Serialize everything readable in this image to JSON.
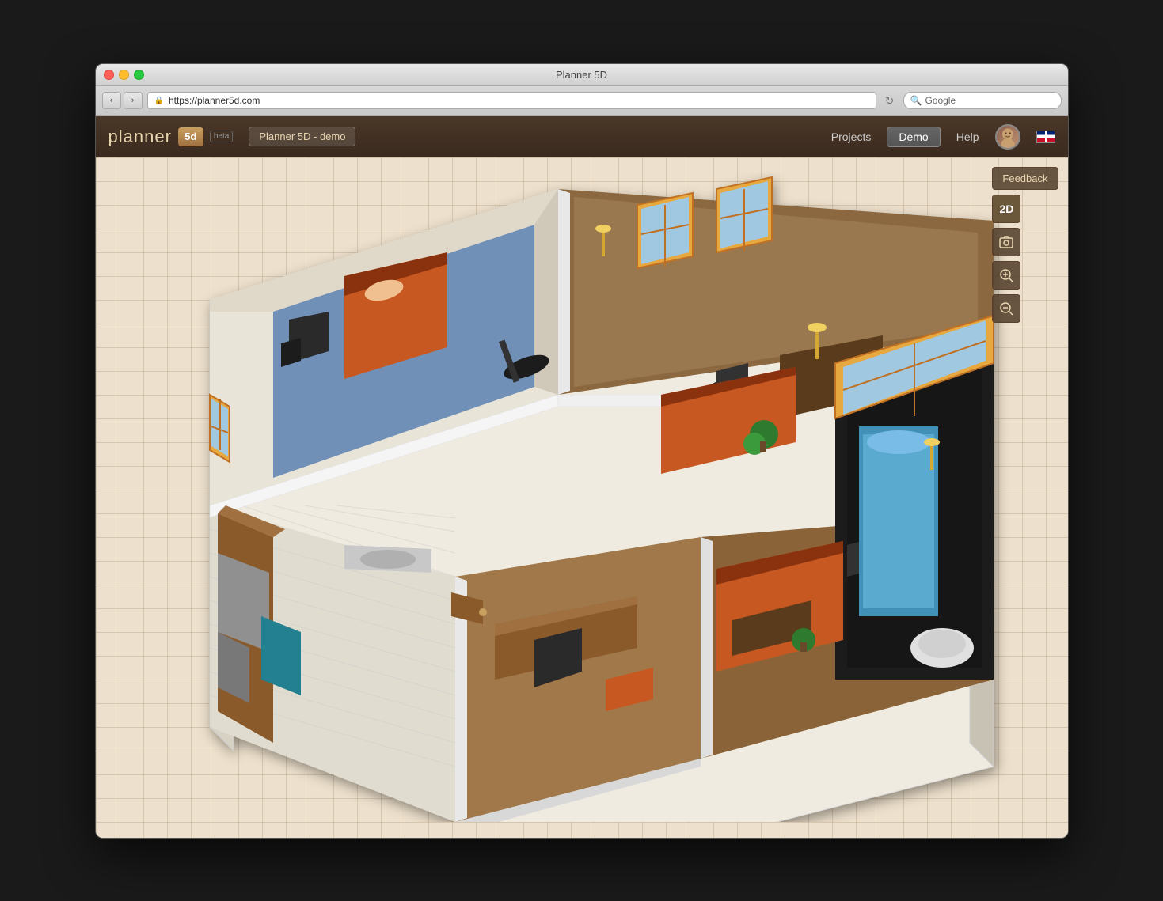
{
  "window": {
    "title": "Planner 5D",
    "url": "https://planner5d.com",
    "search_placeholder": "Google"
  },
  "app": {
    "logo_text": "planner",
    "logo_5d": "5d",
    "beta": "beta",
    "project_name": "Planner 5D - demo",
    "nav": {
      "projects": "Projects",
      "demo": "Demo",
      "help": "Help"
    }
  },
  "tools": {
    "feedback": "Feedback",
    "view_2d": "2D",
    "screenshot": "📷",
    "zoom_in": "🔍+",
    "zoom_out": "🔍-"
  },
  "traffic_lights": {
    "close": "×",
    "minimize": "−",
    "maximize": "+"
  }
}
